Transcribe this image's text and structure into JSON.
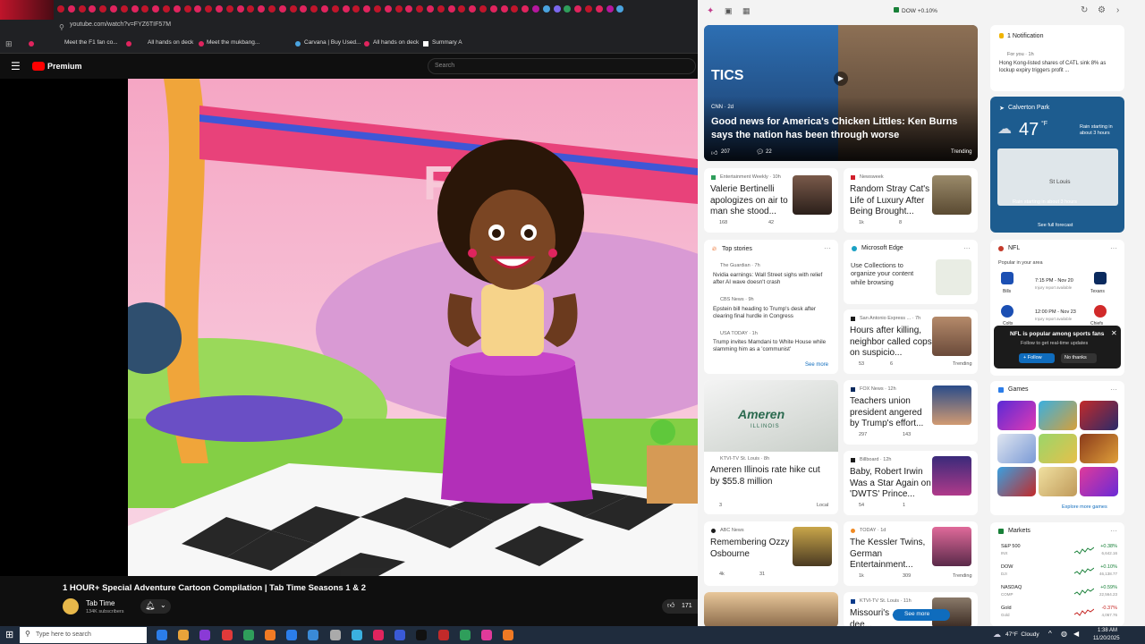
{
  "browser": {
    "url": "youtube.com/watch?v=FYZ6TIF57M",
    "bookmarks": [
      "Meet the F1 fan co...",
      "All hands on deck",
      "Meet the mukbang...",
      "Carvana | Buy Used...",
      "All hands on deck",
      "Summary A"
    ]
  },
  "youtube": {
    "brand": "Premium",
    "search_placeholder": "Search",
    "video_banner_letters": "F    H",
    "video_title": "1 HOUR+ Special Adventure Cartoon Compilation | Tab Time Seasons 1 & 2",
    "channel_name": "Tab Time",
    "subscribers": "134K subscribers",
    "likes": "171"
  },
  "widgets": {
    "top_ticker": "DOW +0.10%",
    "hero": {
      "source": "CNN · 2d",
      "headline": "Good news for America's Chicken Littles: Ken Burns says the nation has been through worse",
      "likes": "207",
      "comments": "22",
      "badge": "Trending",
      "overlay": "TICS"
    },
    "notification": {
      "title": "1 Notification",
      "for_you": "For you · 1h",
      "text": "Hong Kong-listed shares of CATL sink 8% as lockup expiry triggers profit ..."
    },
    "weather": {
      "location": "Calverton Park",
      "temp": "47",
      "unit": "°F",
      "alert": "Rain starting in about 3 hours",
      "map_label": "St Louis",
      "map_alert": "Rain starting in about 3 hours",
      "link": "See full forecast"
    },
    "cards": {
      "ew": {
        "source": "Entertainment Weekly · 10h",
        "headline": "Valerie Bertinelli apologizes on air to man she stood...",
        "likes": "168",
        "comments": "42"
      },
      "newsweek": {
        "source": "Newsweek",
        "headline": "Random Stray Cat's Life of Luxury After Being Brought...",
        "likes": "1k",
        "comments": "8"
      },
      "top_stories": {
        "title": "Top stories",
        "items": [
          {
            "source": "The Guardian · 7h",
            "text": "Nvidia earnings: Wall Street sighs with relief after AI wave doesn't crash"
          },
          {
            "source": "CBS News · 9h",
            "text": "Epstein bill heading to Trump's desk after clearing final hurdle in Congress"
          },
          {
            "source": "USA TODAY · 1h",
            "text": "Trump invites Mamdani to White House while slamming him as a 'communist'"
          }
        ],
        "see_more": "See more"
      },
      "edge": {
        "title": "Microsoft Edge",
        "text": "Use Collections to organize your content while browsing"
      },
      "sa": {
        "source": "San Antonio Express ... · 7h",
        "headline": "Hours after killing, neighbor called cops on suspicio...",
        "likes": "53",
        "comments": "6",
        "badge": "Trending"
      },
      "ameren": {
        "source": "KTVI-TV St. Louis · 8h",
        "headline": "Ameren Illinois rate hike cut by $55.8 million",
        "likes": "3",
        "badge": "Local",
        "logo_text": "Ameren",
        "logo_sub": "ILLINOIS"
      },
      "fox": {
        "source": "FOX News · 12h",
        "headline": "Teachers union president angered by Trump's effort...",
        "likes": "297",
        "comments": "143"
      },
      "billboard": {
        "source": "Billboard · 12h",
        "headline": "Baby, Robert Irwin Was a Star Again on 'DWTS' Prince...",
        "likes": "54",
        "comments": "1"
      },
      "abc": {
        "source": "ABC News",
        "headline": "Remembering Ozzy Osbourne",
        "likes": "4k",
        "comments": "31"
      },
      "today": {
        "source": "TODAY · 1d",
        "headline": "The Kessler Twins, German Entertainment...",
        "likes": "1k",
        "comments": "309",
        "badge": "Trending"
      },
      "ktvi2": {
        "source": "KTVI-TV St. Louis · 11h",
        "headline": "Missouri's ... start to dee...",
        "see_more": "See more"
      }
    },
    "nfl": {
      "title": "NFL",
      "subtitle": "Popular in your area",
      "games": [
        {
          "home": "Bills",
          "time": "7:15 PM - Nov 20",
          "note": "Injury report available",
          "away": "Texans"
        },
        {
          "home": "Colts",
          "time": "12:00 PM - Nov 23",
          "note": "Injury report available",
          "away": "Chiefs"
        }
      ],
      "popup_title": "NFL is popular among sports fans",
      "popup_text": "Follow to get real-time updates",
      "follow": "+ Follow",
      "no_thanks": "No thanks"
    },
    "games": {
      "title": "Games",
      "link": "Explore more games"
    },
    "markets": {
      "title": "Markets",
      "rows": [
        {
          "name": "S&P 500",
          "sub": "INX",
          "change": "+0.38%",
          "value": "6,642.16",
          "color": "#188038"
        },
        {
          "name": "DOW",
          "sub": "DJI",
          "change": "+0.10%",
          "value": "46,138.77",
          "color": "#188038"
        },
        {
          "name": "NASDAQ",
          "sub": "COMP",
          "change": "+0.59%",
          "value": "22,564.23",
          "color": "#188038"
        },
        {
          "name": "Gold",
          "sub": "Gold",
          "change": "-0.37%",
          "value": "4,067.76",
          "color": "#c5221f"
        }
      ]
    }
  },
  "taskbar": {
    "search_placeholder": "Type here to search",
    "weather": "47°F  Cloudy",
    "time": "1:38 AM",
    "date": "11/20/2025"
  }
}
